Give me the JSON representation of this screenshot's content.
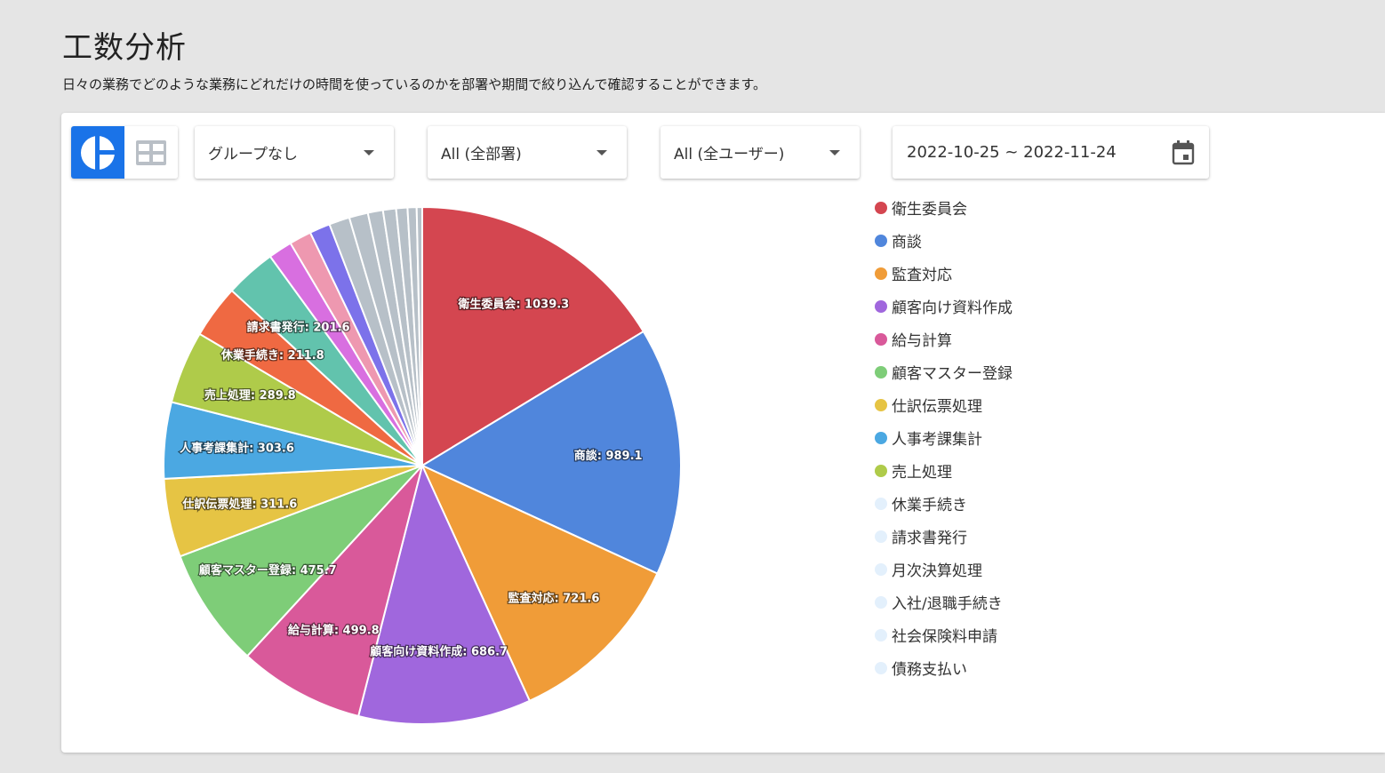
{
  "header": {
    "title": "工数分析",
    "subtitle": "日々の業務でどのような業務にどれだけの時間を使っているのかを部署や期間で絞り込んで確認することができます。"
  },
  "toolbar": {
    "group_select": "グループなし",
    "department_select": "All (全部署)",
    "user_select": "All (全ユーザー)",
    "date_range": "2022-10-25 ~ 2022-11-24"
  },
  "icons": {
    "pie_view": "pie-chart-icon",
    "table_view": "table-grid-icon",
    "calendar": "calendar-icon"
  },
  "colors": {
    "accent": "#1a73e8"
  },
  "chart_data": {
    "type": "pie",
    "slices": [
      {
        "name": "衛生委員会",
        "value": 1039.3,
        "color": "#d44650",
        "label": "衛生委員会: 1039.3",
        "legend": true
      },
      {
        "name": "商談",
        "value": 989.1,
        "color": "#5086dc",
        "label": "商談: 989.1",
        "legend": true
      },
      {
        "name": "監査対応",
        "value": 721.6,
        "color": "#f09c38",
        "label": "監査対応: 721.6",
        "legend": true
      },
      {
        "name": "顧客向け資料作成",
        "value": 686.7,
        "color": "#a067dd",
        "label": "顧客向け資料作成: 686.7",
        "legend": true
      },
      {
        "name": "給与計算",
        "value": 499.8,
        "color": "#d9599a",
        "label": "給与計算: 499.8",
        "legend": true
      },
      {
        "name": "顧客マスター登録",
        "value": 475.7,
        "color": "#7ecd78",
        "label": "顧客マスター登録: 475.7",
        "legend": true
      },
      {
        "name": "仕訳伝票処理",
        "value": 311.6,
        "color": "#e6c444",
        "label": "仕訳伝票処理: 311.6",
        "legend": true
      },
      {
        "name": "人事考課集計",
        "value": 303.6,
        "color": "#4ba8e2",
        "label": "人事考課集計: 303.6",
        "legend": true
      },
      {
        "name": "売上処理",
        "value": 289.8,
        "color": "#afcb4a",
        "label": "売上処理: 289.8",
        "legend": true
      },
      {
        "name": "休業手続き",
        "value": 211.8,
        "color": "#ef6942",
        "label": "休業手続き: 211.8",
        "legend": true
      },
      {
        "name": "請求書発行",
        "value": 201.6,
        "color": "#62c3ad",
        "label": "請求書発行: 201.6",
        "legend": true
      },
      {
        "name": "月次決算処理",
        "value": 95,
        "color": "#d86fe0",
        "label": "",
        "legend": true
      },
      {
        "name": "入社/退職手続き",
        "value": 88,
        "color": "#ee98b0",
        "label": "",
        "legend": true
      },
      {
        "name": "社会保険料申請",
        "value": 82,
        "color": "#7c72ea",
        "label": "",
        "legend": true
      },
      {
        "name": "債務支払い",
        "value": 82,
        "color": "#b7c0c8",
        "label": "",
        "legend": true
      },
      {
        "name": "",
        "value": 75,
        "color": "#b7c0c8",
        "label": "",
        "legend": false
      },
      {
        "name": "",
        "value": 60,
        "color": "#b7c0c8",
        "label": "",
        "legend": false
      },
      {
        "name": "",
        "value": 52,
        "color": "#b7c0c8",
        "label": "",
        "legend": false
      },
      {
        "name": "",
        "value": 45,
        "color": "#b7c0c8",
        "label": "",
        "legend": false
      },
      {
        "name": "",
        "value": 36,
        "color": "#b7c0c8",
        "label": "",
        "legend": false
      },
      {
        "name": "",
        "value": 22,
        "color": "#b7c0c8",
        "label": "",
        "legend": false
      }
    ],
    "legend_placement": "right",
    "legend_active_count": 9,
    "legend_inactive_color": "#e3f0fc"
  }
}
